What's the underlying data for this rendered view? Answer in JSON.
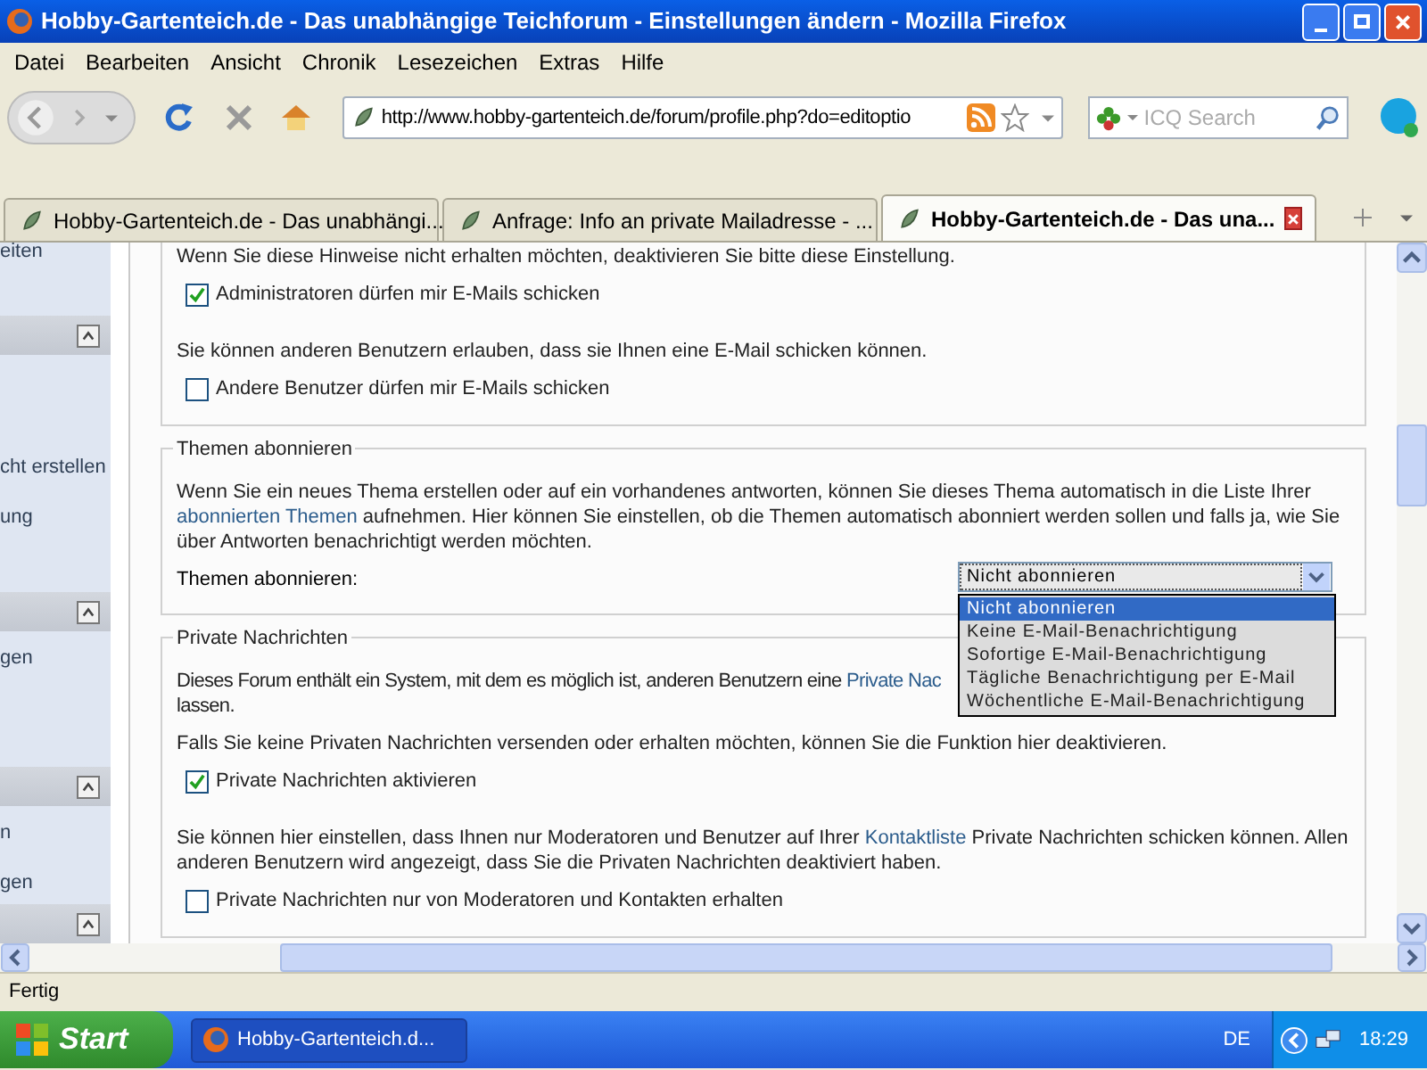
{
  "window": {
    "title": "Hobby-Gartenteich.de - Das unabhängige Teichforum - Einstellungen ändern - Mozilla Firefox"
  },
  "menu": [
    "Datei",
    "Bearbeiten",
    "Ansicht",
    "Chronik",
    "Lesezeichen",
    "Extras",
    "Hilfe"
  ],
  "toolbar": {
    "url": "http://www.hobby-gartenteich.de/forum/profile.php?do=editoptio",
    "search_placeholder": "ICQ Search"
  },
  "tabs": [
    {
      "label": "Hobby-Gartenteich.de - Das unabhängi...",
      "selected": false
    },
    {
      "label": "Anfrage: Info an private Mailadresse - ...",
      "selected": false
    },
    {
      "label": "Hobby-Gartenteich.de - Das una...",
      "selected": true
    }
  ],
  "sidebar": {
    "top_items": [
      "eiten"
    ],
    "groups": [
      {
        "items": [
          "cht erstellen",
          "ung"
        ]
      },
      {
        "items": [
          "gen"
        ]
      },
      {
        "items": [
          "n",
          "gen"
        ]
      }
    ]
  },
  "sections": [
    {
      "blocks": [
        {
          "kind": "paragraph",
          "parts": [
            {
              "kind": "text",
              "text": "Wenn Sie diese Hinweise nicht erhalten möchten, deaktivieren Sie bitte diese Einstellung."
            }
          ]
        },
        {
          "kind": "checkbox",
          "label": "Administratoren dürfen mir E-Mails schicken",
          "checked": true
        },
        {
          "kind": "paragraph",
          "parts": [
            {
              "kind": "text",
              "text": "Sie können anderen Benutzern erlauben, dass sie Ihnen eine E-Mail schicken können."
            }
          ]
        },
        {
          "kind": "checkbox",
          "label": "Andere Benutzer dürfen mir E-Mails schicken",
          "checked": false
        }
      ]
    },
    {
      "legend": "Themen abonnieren",
      "blocks": [
        {
          "kind": "paragraph",
          "parts": [
            {
              "kind": "text",
              "text": "Wenn Sie ein neues Thema erstellen oder auf ein vorhandenes antworten, können Sie dieses Thema automatisch in die Liste Ihrer "
            },
            {
              "kind": "link",
              "text": "abonnierten Themen"
            },
            {
              "kind": "text",
              "text": " aufnehmen. Hier können Sie einstellen, ob die Themen automatisch abonniert werden sollen und falls ja, wie Sie über Antworten benachrichtigt werden möchten."
            }
          ]
        },
        {
          "kind": "select",
          "label": "Themen abonnieren:",
          "value": "Nicht abonnieren",
          "expanded": true,
          "options": [
            {
              "text": "Nicht abonnieren",
              "selected": true
            },
            {
              "text": "Keine E-Mail-Benachrichtigung",
              "selected": false
            },
            {
              "text": "Sofortige E-Mail-Benachrichtigung",
              "selected": false
            },
            {
              "text": "Tägliche Benachrichtigung per E-Mail",
              "selected": false
            },
            {
              "text": "Wöchentliche E-Mail-Benachrichtigung",
              "selected": false
            }
          ]
        }
      ]
    },
    {
      "legend": "Private Nachrichten",
      "blocks": [
        {
          "kind": "paragraph",
          "parts": [
            {
              "kind": "text",
              "text": "Dieses Forum enthält ein System, mit dem es möglich ist, anderen Benutzern eine "
            },
            {
              "kind": "link",
              "text": "Private Nac"
            },
            {
              "kind": "break"
            },
            {
              "kind": "text",
              "text": "lassen."
            }
          ]
        },
        {
          "kind": "paragraph",
          "parts": [
            {
              "kind": "text",
              "text": "Falls Sie keine Privaten Nachrichten versenden oder erhalten möchten, können Sie die Funktion hier deaktivieren."
            }
          ]
        },
        {
          "kind": "checkbox",
          "label": "Private Nachrichten aktivieren",
          "checked": true
        },
        {
          "kind": "paragraph",
          "parts": [
            {
              "kind": "text",
              "text": "Sie können hier einstellen, dass Ihnen nur Moderatoren und Benutzer auf Ihrer "
            },
            {
              "kind": "link",
              "text": "Kontaktliste"
            },
            {
              "kind": "text",
              "text": " Private Nachrichten schicken können. Allen anderen Benutzern wird angezeigt, dass Sie die Privaten Nachrichten deaktiviert haben."
            }
          ]
        },
        {
          "kind": "checkbox",
          "label": "Private Nachrichten nur von Moderatoren und Kontakten erhalten",
          "checked": false
        }
      ]
    }
  ],
  "status_bar": {
    "text": "Fertig"
  },
  "taskbar": {
    "start": "Start",
    "task": "Hobby-Gartenteich.d...",
    "language": "DE",
    "time": "18:29"
  }
}
